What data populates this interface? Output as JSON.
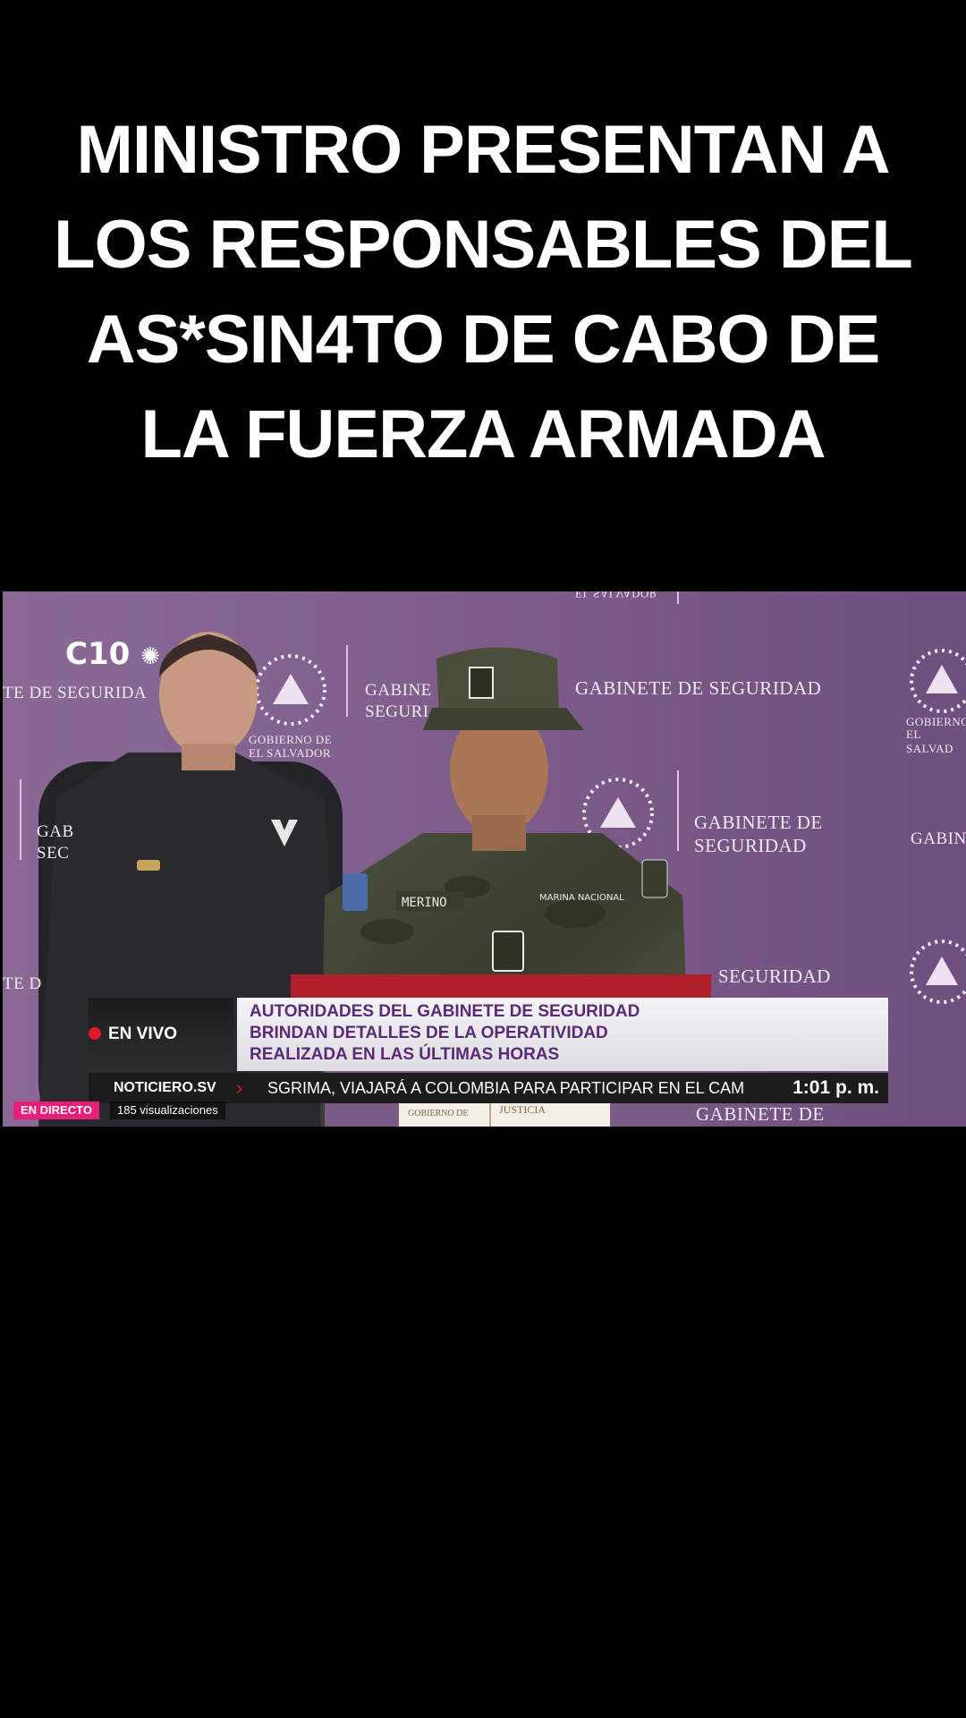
{
  "headline": {
    "line1": "MINISTRO PRESENTAN A",
    "line2": "LOS RESPONSABLES DEL",
    "line3": "AS*SIN4TO DE CABO DE",
    "line4": "LA FUERZA ARMADA"
  },
  "video": {
    "channel_logo": "C10",
    "backdrop": {
      "gabinete_top": "GABINETE DE SEGURIDAD",
      "gabinete_mid_1": "GABINETE DE",
      "gabinete_mid_2": "SEGURIDAD",
      "seguridad_low": "SEGURIDAD",
      "gabinete_bottom": "GABINETE DE",
      "left_fragment": "TE DE SEGURIDA",
      "gobierno_1": "GOBIERNO DE",
      "gobierno_2": "EL SALVADOR",
      "gabine_fragment_1": "GABINE",
      "gabine_fragment_2": "SEGURI",
      "right_fragment": "GABIN",
      "top_fragment": "EL SALVADOR",
      "gab_left": "GAB",
      "sec_left": "SEC",
      "te_d": "TE D",
      "gobierno_right_1": "GOBIERNO",
      "gobierno_right_2": "EL SALVAD",
      "podium_1": "GOBIERNO DE",
      "podium_2": "JUSTICIA"
    },
    "uniform": {
      "name_tag": "MERINO",
      "branch_tag": "MARINA NACIONAL"
    },
    "lower_third": {
      "live_label": "EN VIVO",
      "headline_1": "AUTORIDADES DEL GABINETE DE SEGURIDAD",
      "headline_2": "BRINDAN DETALLES DE LA OPERATIVIDAD",
      "headline_3": "REALIZADA EN LAS ÚLTIMAS HORAS",
      "source": "NOTICIERO.SV",
      "ticker": "SGRIMA, VIAJARÁ A COLOMBIA PARA PARTICIPAR EN EL CAM",
      "time": "1:01 p. m."
    },
    "badges": {
      "live": "EN DIRECTO",
      "views": "185 visualizaciones"
    }
  },
  "colors": {
    "backdrop": "#7b5a86",
    "lower_third_text": "#5b2a76",
    "live_badge": "#e91e7a",
    "ticker_bg": "#1c1c1c"
  }
}
